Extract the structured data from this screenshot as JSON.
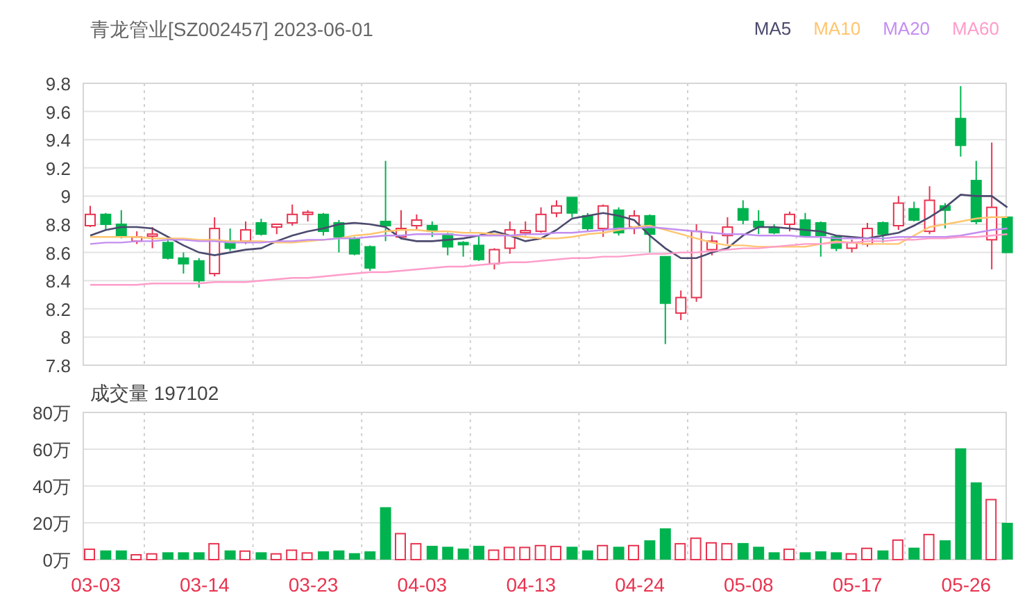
{
  "header": {
    "title": "青龙管业[SZ002457] 2023-06-01"
  },
  "price": {
    "chart_data": {
      "type": "candlestick",
      "grid": true,
      "ylim": [
        7.8,
        9.8
      ],
      "yticks": [
        9.8,
        9.6,
        9.4,
        9.2,
        9,
        8.8,
        8.6,
        8.4,
        8.2,
        8,
        7.8
      ],
      "categories": [
        null,
        null,
        null,
        null,
        null,
        null,
        null,
        null,
        null,
        null,
        null,
        null,
        null,
        null,
        null,
        null,
        null,
        null,
        null,
        null,
        null,
        null,
        null,
        null,
        null,
        null,
        null,
        null,
        null,
        null,
        null,
        null,
        null,
        null,
        null,
        null,
        null,
        null,
        null,
        null,
        null,
        null,
        null,
        null,
        null,
        null,
        null,
        null,
        null,
        null,
        null,
        null,
        null,
        null,
        null,
        null,
        null,
        null,
        null,
        null
      ],
      "ohlc": [
        [
          8.79,
          8.93,
          8.78,
          8.87
        ],
        [
          8.87,
          8.88,
          8.76,
          8.8
        ],
        [
          8.8,
          8.9,
          8.7,
          8.72
        ],
        [
          8.68,
          8.75,
          8.66,
          8.71
        ],
        [
          8.72,
          8.78,
          8.63,
          8.73
        ],
        [
          8.67,
          8.7,
          8.55,
          8.56
        ],
        [
          8.56,
          8.6,
          8.45,
          8.52
        ],
        [
          8.54,
          8.56,
          8.35,
          8.4
        ],
        [
          8.45,
          8.85,
          8.43,
          8.77
        ],
        [
          8.68,
          8.77,
          8.61,
          8.63
        ],
        [
          8.68,
          8.82,
          8.66,
          8.76
        ],
        [
          8.81,
          8.84,
          8.72,
          8.73
        ],
        [
          8.78,
          8.8,
          8.73,
          8.8
        ],
        [
          8.81,
          8.94,
          8.79,
          8.87
        ],
        [
          8.875,
          8.9,
          8.82,
          8.885
        ],
        [
          8.87,
          8.88,
          8.72,
          8.75
        ],
        [
          8.81,
          8.83,
          8.6,
          8.71
        ],
        [
          8.7,
          8.71,
          8.58,
          8.59
        ],
        [
          8.64,
          8.65,
          8.47,
          8.49
        ],
        [
          8.82,
          9.25,
          8.68,
          8.79
        ],
        [
          8.71,
          8.9,
          8.7,
          8.77
        ],
        [
          8.79,
          8.87,
          8.76,
          8.83
        ],
        [
          8.79,
          8.82,
          8.71,
          8.75
        ],
        [
          8.73,
          8.74,
          8.58,
          8.64
        ],
        [
          8.67,
          8.68,
          8.57,
          8.66
        ],
        [
          8.65,
          8.72,
          8.54,
          8.55
        ],
        [
          8.52,
          8.63,
          8.48,
          8.62
        ],
        [
          8.63,
          8.82,
          8.59,
          8.76
        ],
        [
          8.74,
          8.82,
          8.72,
          8.755
        ],
        [
          8.75,
          8.92,
          8.74,
          8.87
        ],
        [
          8.88,
          8.97,
          8.85,
          8.93
        ],
        [
          8.99,
          8.99,
          8.85,
          8.88
        ],
        [
          8.86,
          8.88,
          8.75,
          8.77
        ],
        [
          8.77,
          8.94,
          8.71,
          8.93
        ],
        [
          8.9,
          8.92,
          8.72,
          8.74
        ],
        [
          8.78,
          8.9,
          8.73,
          8.86
        ],
        [
          8.86,
          8.87,
          8.6,
          8.73
        ],
        [
          8.57,
          8.57,
          7.95,
          8.24
        ],
        [
          8.17,
          8.33,
          8.12,
          8.28
        ],
        [
          8.28,
          8.8,
          8.25,
          8.75
        ],
        [
          8.62,
          8.72,
          8.58,
          8.68
        ],
        [
          8.72,
          8.85,
          8.66,
          8.78
        ],
        [
          8.91,
          8.97,
          8.8,
          8.83
        ],
        [
          8.82,
          8.9,
          8.73,
          8.78
        ],
        [
          8.77,
          8.8,
          8.73,
          8.74
        ],
        [
          8.8,
          8.89,
          8.75,
          8.87
        ],
        [
          8.83,
          8.88,
          8.71,
          8.72
        ],
        [
          8.81,
          8.82,
          8.57,
          8.72
        ],
        [
          8.71,
          8.72,
          8.61,
          8.63
        ],
        [
          8.63,
          8.69,
          8.6,
          8.67
        ],
        [
          8.66,
          8.81,
          8.64,
          8.77
        ],
        [
          8.81,
          8.82,
          8.67,
          8.73
        ],
        [
          8.79,
          9.0,
          8.76,
          8.95
        ],
        [
          8.91,
          8.96,
          8.82,
          8.83
        ],
        [
          8.75,
          9.07,
          8.73,
          8.97
        ],
        [
          8.93,
          8.95,
          8.77,
          8.9
        ],
        [
          9.55,
          9.78,
          9.28,
          9.36
        ],
        [
          9.11,
          9.25,
          8.8,
          8.82
        ],
        [
          8.69,
          9.38,
          8.48,
          8.92
        ],
        [
          8.85,
          8.85,
          8.6,
          8.6
        ]
      ]
    }
  },
  "averages": {
    "chart_data": {
      "type": "line",
      "series": [
        {
          "name": "MA5",
          "color": "#4b4a6e",
          "values": [
            8.72,
            8.76,
            8.78,
            8.78,
            8.77,
            8.71,
            8.65,
            8.6,
            8.58,
            8.6,
            8.62,
            8.63,
            8.68,
            8.72,
            8.75,
            8.77,
            8.8,
            8.81,
            8.8,
            8.78,
            8.7,
            8.68,
            8.68,
            8.69,
            8.7,
            8.72,
            8.75,
            8.72,
            8.68,
            8.7,
            8.76,
            8.84,
            8.86,
            8.88,
            8.86,
            8.83,
            8.72,
            8.63,
            8.56,
            8.56,
            8.6,
            8.63,
            8.72,
            8.78,
            8.78,
            8.77,
            8.76,
            8.75,
            8.72,
            8.71,
            8.7,
            8.72,
            8.74,
            8.79,
            8.85,
            8.92,
            9.01,
            9.0,
            9.0,
            8.92
          ]
        },
        {
          "name": "MA10",
          "color": "#ffc56e",
          "values": [
            8.71,
            8.71,
            8.71,
            8.71,
            8.7,
            8.7,
            8.7,
            8.69,
            8.69,
            8.68,
            8.68,
            8.68,
            8.67,
            8.67,
            8.68,
            8.69,
            8.7,
            8.72,
            8.73,
            8.75,
            8.76,
            8.76,
            8.75,
            8.75,
            8.74,
            8.74,
            8.73,
            8.72,
            8.71,
            8.7,
            8.7,
            8.71,
            8.73,
            8.74,
            8.76,
            8.78,
            8.79,
            8.76,
            8.73,
            8.7,
            8.67,
            8.65,
            8.65,
            8.64,
            8.64,
            8.64,
            8.64,
            8.66,
            8.68,
            8.67,
            8.66,
            8.66,
            8.66,
            8.72,
            8.78,
            8.8,
            8.82,
            8.84,
            8.85,
            8.85
          ]
        },
        {
          "name": "MA20",
          "color": "#c38ef0",
          "values": [
            8.66,
            8.67,
            8.67,
            8.68,
            8.68,
            8.69,
            8.69,
            8.68,
            8.68,
            8.67,
            8.67,
            8.67,
            8.68,
            8.68,
            8.69,
            8.69,
            8.7,
            8.7,
            8.71,
            8.72,
            8.72,
            8.73,
            8.73,
            8.73,
            8.72,
            8.72,
            8.72,
            8.72,
            8.73,
            8.73,
            8.74,
            8.74,
            8.75,
            8.76,
            8.77,
            8.77,
            8.78,
            8.77,
            8.76,
            8.75,
            8.74,
            8.73,
            8.73,
            8.72,
            8.72,
            8.72,
            8.71,
            8.71,
            8.7,
            8.7,
            8.7,
            8.7,
            8.71,
            8.71,
            8.71,
            8.71,
            8.72,
            8.74,
            8.76,
            8.77
          ]
        },
        {
          "name": "MA60",
          "color": "#ff9cc9",
          "values": [
            8.37,
            8.37,
            8.37,
            8.37,
            8.38,
            8.38,
            8.38,
            8.38,
            8.39,
            8.39,
            8.39,
            8.4,
            8.41,
            8.42,
            8.42,
            8.43,
            8.44,
            8.45,
            8.46,
            8.46,
            8.47,
            8.48,
            8.49,
            8.5,
            8.5,
            8.51,
            8.52,
            8.53,
            8.53,
            8.54,
            8.55,
            8.56,
            8.56,
            8.57,
            8.57,
            8.58,
            8.59,
            8.59,
            8.6,
            8.6,
            8.61,
            8.62,
            8.63,
            8.63,
            8.64,
            8.65,
            8.66,
            8.66,
            8.67,
            8.67,
            8.68,
            8.68,
            8.69,
            8.69,
            8.7,
            8.7,
            8.71,
            8.71,
            8.72,
            8.73
          ]
        }
      ],
      "ylim": [
        7.8,
        9.8
      ]
    }
  },
  "volume": {
    "chart_data": {
      "type": "bar",
      "title": "成交量 197102",
      "stacked": true,
      "grid": true,
      "categories": [
        "03-03",
        null,
        null,
        null,
        null,
        null,
        null,
        "03-14",
        null,
        null,
        null,
        null,
        null,
        null,
        "03-23",
        null,
        null,
        null,
        null,
        null,
        null,
        "04-03",
        null,
        null,
        null,
        null,
        null,
        null,
        "04-13",
        null,
        null,
        null,
        null,
        null,
        null,
        "04-24",
        null,
        null,
        null,
        null,
        null,
        null,
        "05-08",
        null,
        null,
        null,
        null,
        null,
        null,
        "05-17",
        null,
        null,
        null,
        null,
        null,
        null,
        "05-26",
        null,
        null,
        null
      ],
      "series": [
        {
          "color": "#e8334f",
          "values": [
            6,
            null,
            null,
            3,
            3.5,
            null,
            null,
            null,
            9,
            null,
            5,
            null,
            3.5,
            5.5,
            4,
            null,
            null,
            null,
            null,
            null,
            14.5,
            9,
            null,
            null,
            null,
            null,
            5.5,
            7,
            7,
            8,
            7.5,
            null,
            null,
            8,
            null,
            8,
            null,
            null,
            9,
            12,
            9.5,
            9,
            null,
            null,
            null,
            6,
            null,
            null,
            null,
            3.5,
            6.5,
            null,
            11,
            null,
            14,
            null,
            null,
            null,
            33,
            null
          ]
        },
        {
          "color": "#00b34f",
          "values": [
            null,
            5,
            5,
            null,
            null,
            4,
            4,
            4,
            null,
            5,
            null,
            4,
            null,
            null,
            null,
            4.5,
            5,
            3.5,
            4.5,
            28.5,
            null,
            null,
            7.5,
            7,
            6,
            7.5,
            null,
            null,
            null,
            null,
            null,
            7,
            5,
            null,
            7,
            null,
            10.5,
            17,
            null,
            null,
            null,
            null,
            9,
            7,
            4,
            null,
            4,
            4.5,
            4,
            null,
            null,
            5,
            null,
            6.5,
            null,
            10.5,
            60.5,
            42,
            null,
            20
          ]
        }
      ],
      "ylim": [
        0,
        80
      ],
      "yticks": [
        {
          "value": 0,
          "label": "0万"
        },
        {
          "value": 20,
          "label": "20万"
        },
        {
          "value": 40,
          "label": "40万"
        },
        {
          "value": 60,
          "label": "60万"
        },
        {
          "value": 80,
          "label": "80万"
        }
      ]
    }
  }
}
